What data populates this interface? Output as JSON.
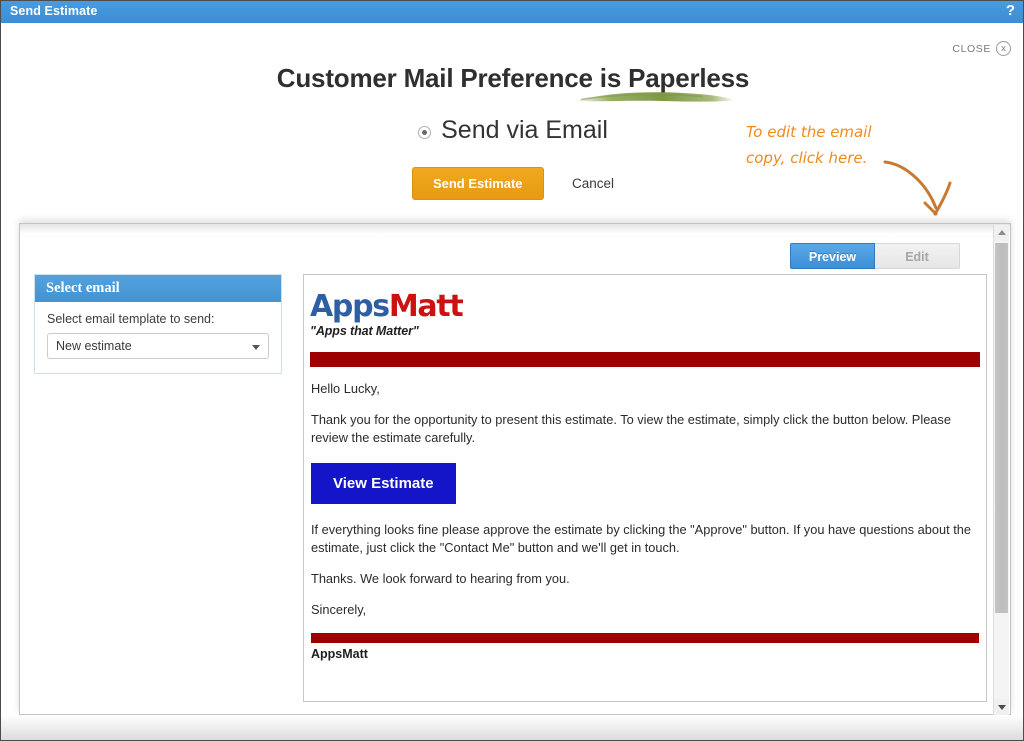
{
  "window": {
    "title": "Send Estimate",
    "help_icon": "?",
    "close_label": "CLOSE",
    "close_icon": "x"
  },
  "headline": "Customer Mail Preference is Paperless",
  "send_option": {
    "label": "Send via Email",
    "selected": true
  },
  "actions": {
    "send_label": "Send Estimate",
    "cancel_label": "Cancel"
  },
  "annotation": {
    "line1": "To edit the email",
    "line2": "copy, click here.",
    "color": "#f08a1e"
  },
  "tabs": [
    {
      "label": "Preview",
      "active": true
    },
    {
      "label": "Edit",
      "active": false
    }
  ],
  "select_email": {
    "title": "Select email",
    "field_label": "Select email template to send:",
    "selected_value": "New estimate",
    "options": [
      "New estimate"
    ]
  },
  "email_preview": {
    "logo_first": "Apps",
    "logo_second": "Matt",
    "tagline": "\"Apps that Matter\"",
    "greeting": "Hello Lucky,",
    "paragraph1": "Thank you for the opportunity to present this estimate. To view the estimate, simply click the button below. Please review the estimate carefully.",
    "view_button": "View Estimate",
    "paragraph2": "If everything looks fine please approve the estimate by clicking the \"Approve\" button. If you have questions about the estimate, just click the \"Contact Me\" button and we'll get in touch.",
    "paragraph3": "Thanks. We look forward to hearing from you.",
    "closing": "Sincerely,",
    "signature": "AppsMatt",
    "band_color": "#9c0000",
    "button_color": "#1414c8"
  },
  "colors": {
    "titlebar": "#3c92d8",
    "accent_blue": "#4a9ad8",
    "accent_orange": "#e89a12",
    "swoosh_green": "#8aa04e"
  }
}
